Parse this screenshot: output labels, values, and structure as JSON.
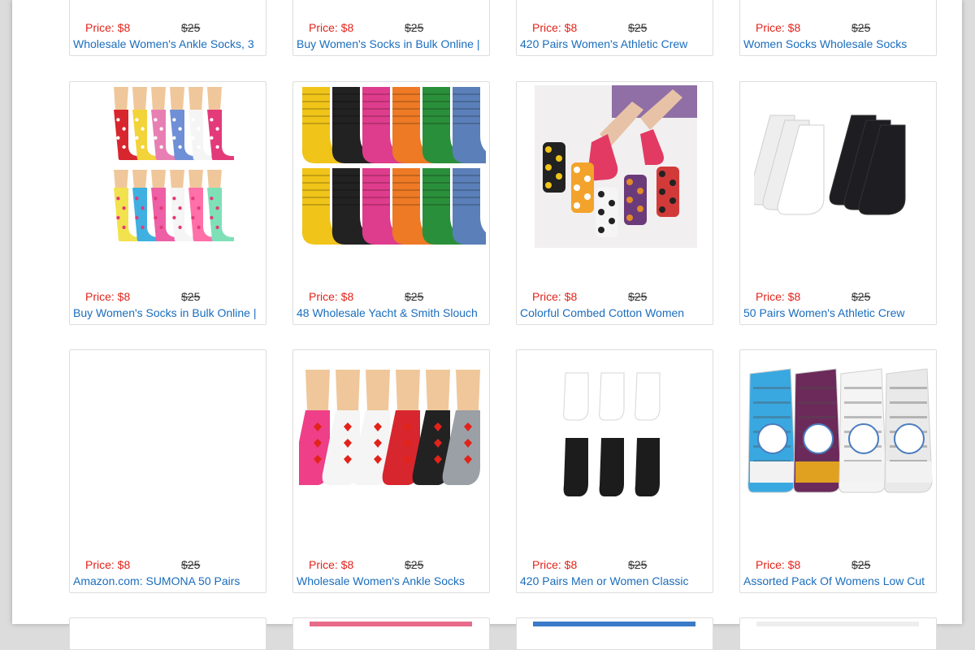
{
  "currency_symbol": "$",
  "products": [
    {
      "title": "Wholesale Women's Ankle Socks, 3",
      "price_label": "Price: $8",
      "old_price": "$25",
      "image": "socks-photo"
    },
    {
      "title": "Buy Women's Socks in Bulk Online |",
      "price_label": "Price: $8",
      "old_price": "$25",
      "image": "socks-photo"
    },
    {
      "title": "420 Pairs Women's Athletic Crew",
      "price_label": "Price: $8",
      "old_price": "$25",
      "image": "socks-photo"
    },
    {
      "title": "Women Socks Wholesale Socks",
      "price_label": "Price: $8",
      "old_price": "$25",
      "image": "socks-photo"
    },
    {
      "title": "Buy Women's Socks in Bulk Online |",
      "price_label": "Price: $8",
      "old_price": "$25",
      "image": "novelty-crew-socks-on-mannequin-feet"
    },
    {
      "title": "48 Wholesale Yacht & Smith Slouch",
      "price_label": "Price: $8",
      "old_price": "$25",
      "image": "colorful-slouch-socks"
    },
    {
      "title": "Colorful Combed Cotton Women",
      "price_label": "Price: $8",
      "old_price": "$25",
      "image": "polka-dot-socks-on-legs"
    },
    {
      "title": "50 Pairs Women's Athletic Crew",
      "price_label": "Price: $8",
      "old_price": "$25",
      "image": "white-and-black-crew-socks"
    },
    {
      "title": "Amazon.com: SUMONA 50 Pairs",
      "price_label": "Price: $8",
      "old_price": "$25",
      "image": "blank"
    },
    {
      "title": "Wholesale Women's Ankle Socks",
      "price_label": "Price: $8",
      "old_price": "$25",
      "image": "valentine-socks-on-mannequin-feet"
    },
    {
      "title": "420 Pairs Men or Women Classic",
      "price_label": "Price: $8",
      "old_price": "$25",
      "image": "low-cut-white-black-socks"
    },
    {
      "title": "Assorted Pack Of Womens Low Cut",
      "price_label": "Price: $8",
      "old_price": "$25",
      "image": "assorted-low-cut-socks-pack"
    }
  ]
}
